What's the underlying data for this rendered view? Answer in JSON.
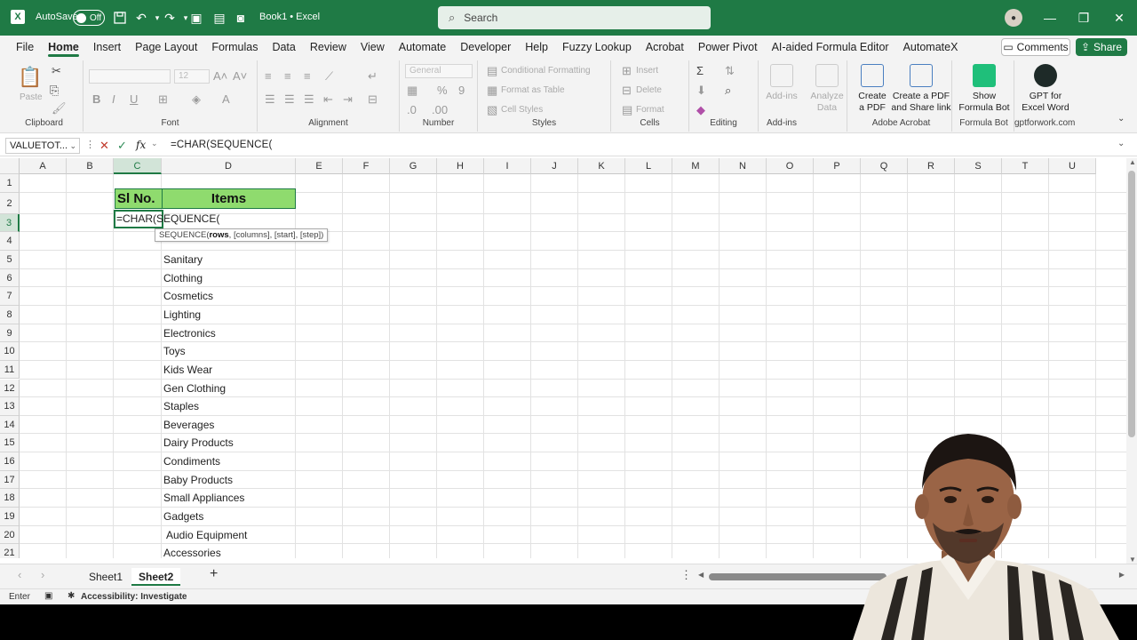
{
  "titlebar": {
    "autosave_label": "AutoSave",
    "autosave_state": "Off",
    "doc_title": "Book1 • Excel",
    "search_placeholder": "Search"
  },
  "menu": {
    "tabs": [
      "File",
      "Home",
      "Insert",
      "Page Layout",
      "Formulas",
      "Data",
      "Review",
      "View",
      "Automate",
      "Developer",
      "Help",
      "Fuzzy Lookup",
      "Acrobat",
      "Power Pivot",
      "AI-aided Formula Editor",
      "AutomateX"
    ],
    "active": "Home",
    "comments_label": "Comments",
    "share_label": "Share"
  },
  "ribbon": {
    "clipboard": {
      "label": "Clipboard",
      "paste": "Paste"
    },
    "font": {
      "label": "Font",
      "size": "12"
    },
    "alignment": {
      "label": "Alignment"
    },
    "number": {
      "label": "Number",
      "format": "General"
    },
    "styles": {
      "label": "Styles",
      "conditional": "Conditional Formatting",
      "format_table": "Format as Table",
      "cell_styles": "Cell Styles"
    },
    "cells": {
      "label": "Cells",
      "insert": "Insert",
      "delete": "Delete",
      "format": "Format"
    },
    "editing": {
      "label": "Editing"
    },
    "addins": {
      "label": "Add-ins",
      "addins_btn": "Add-ins",
      "analyze_line1": "Analyze",
      "analyze_line2": "Data"
    },
    "acrobat": {
      "label": "Adobe Acrobat",
      "create_pdf_line1": "Create",
      "create_pdf_line2": "a PDF",
      "share_pdf_line1": "Create a PDF",
      "share_pdf_line2": "and Share link"
    },
    "formula_bot": {
      "label": "Formula Bot",
      "btn_line1": "Show",
      "btn_line2": "Formula Bot"
    },
    "gptforwork": {
      "label": "gptforwork.com",
      "btn_line1": "GPT for",
      "btn_line2": "Excel Word"
    }
  },
  "formula_bar": {
    "name_box": "VALUETOT...",
    "fx": "fx",
    "formula": "=CHAR(SEQUENCE("
  },
  "grid": {
    "columns": [
      "A",
      "B",
      "C",
      "D",
      "E",
      "F",
      "G",
      "H",
      "I",
      "J",
      "K",
      "L",
      "M",
      "N",
      "O",
      "P",
      "Q",
      "R",
      "S",
      "T",
      "U"
    ],
    "rows": [
      "1",
      "2",
      "3",
      "4",
      "5",
      "6",
      "7",
      "8",
      "9",
      "10",
      "11",
      "12",
      "13",
      "14",
      "15",
      "16",
      "17",
      "18",
      "19",
      "20",
      "21"
    ],
    "header_sl": "Sl No.",
    "header_items": "Items",
    "active_cell_text": "=CHAR(SEQUENCE(",
    "tooltip_fn": "SEQUENCE(",
    "tooltip_bold": "rows",
    "tooltip_rest": ", [columns], [start], [step])",
    "items": [
      "Sanitary",
      "Clothing",
      "Cosmetics",
      "Lighting",
      "Electronics",
      "Toys",
      "Kids Wear",
      "Gen Clothing",
      "Staples",
      "Beverages",
      "Dairy Products",
      "Condiments",
      "Baby Products",
      "Small Appliances",
      "Gadgets",
      "Audio Equipment",
      "Accessories"
    ]
  },
  "sheets": {
    "tabs": [
      "Sheet1",
      "Sheet2"
    ],
    "active": "Sheet2"
  },
  "status": {
    "mode": "Enter",
    "accessibility": "Accessibility: Investigate"
  },
  "colors": {
    "accent": "#1f7a45",
    "header_fill": "#8fdb6e"
  }
}
